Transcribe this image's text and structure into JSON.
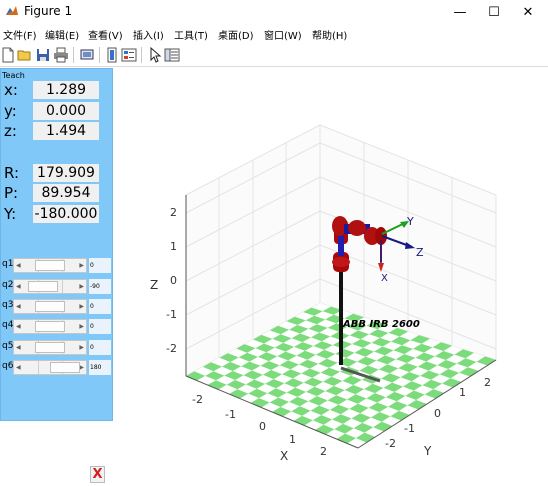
{
  "window": {
    "title": "Figure 1",
    "minimize": "—",
    "maximize": "☐",
    "close": "✕"
  },
  "menubar": {
    "items": [
      "文件(F)",
      "编辑(E)",
      "查看(V)",
      "插入(I)",
      "工具(T)",
      "桌面(D)",
      "窗口(W)",
      "帮助(H)"
    ]
  },
  "toolbar": {
    "icons": [
      "new-figure-icon",
      "open-icon",
      "save-icon",
      "print-icon",
      "link-icon",
      "insert-colorbar-icon",
      "insert-legend-icon",
      "select-cursor-icon",
      "property-inspector-icon"
    ]
  },
  "teach": {
    "title": "Teach",
    "pose": [
      {
        "label": "x:",
        "value": "1.289"
      },
      {
        "label": "y:",
        "value": "0.000"
      },
      {
        "label": "z:",
        "value": "1.494"
      },
      {
        "label": "R:",
        "value": "179.909"
      },
      {
        "label": "P:",
        "value": "89.954"
      },
      {
        "label": "Y:",
        "value": "-180.000"
      }
    ],
    "joints": [
      {
        "label": "q1",
        "value": "0",
        "fraction": 0.5
      },
      {
        "label": "q2",
        "value": "-90",
        "fraction": 0.25
      },
      {
        "label": "q3",
        "value": "0",
        "fraction": 0.5
      },
      {
        "label": "q4",
        "value": "0",
        "fraction": 0.5
      },
      {
        "label": "q5",
        "value": "0",
        "fraction": 0.5
      },
      {
        "label": "q6",
        "value": "180",
        "fraction": 1.0
      }
    ],
    "close_label": "X"
  },
  "plot": {
    "robot_name": "ABB IRB 2600",
    "z_label": "Z",
    "x_label": "X",
    "y_label": "Y",
    "z_ticks": [
      "2",
      "1",
      "0",
      "-1",
      "-2"
    ],
    "x_ticks": [
      "-2",
      "-1",
      "0",
      "1",
      "2"
    ],
    "y_ticks": [
      "2",
      "1",
      "0",
      "-1",
      "-2"
    ],
    "frame_labels": {
      "x": "X",
      "y": "Y",
      "z": "Z"
    },
    "colors": {
      "check_green": "#7cdc7c",
      "link_red": "#a80a0a",
      "joint_blue": "#1010a0",
      "frame_arrow": "#1a1a80",
      "y_arrow": "#1aa01a"
    }
  }
}
